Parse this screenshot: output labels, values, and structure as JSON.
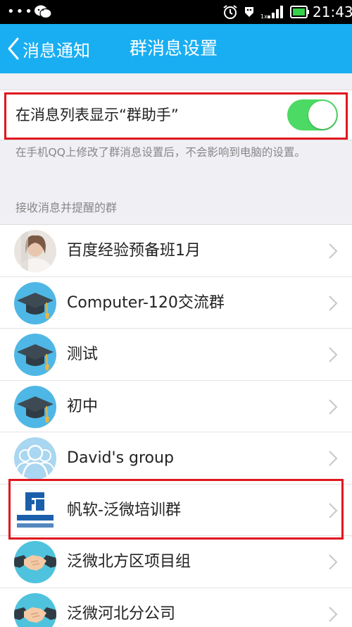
{
  "status_bar": {
    "time": "21:43",
    "left_dots": "•••"
  },
  "nav": {
    "back_label": "消息通知",
    "title": "群消息设置"
  },
  "toggle": {
    "label": "在消息列表显示“群助手”",
    "on": true
  },
  "hint": "在手机QQ上修改了群消息设置后，不会影响到电脑的设置。",
  "section_title": "接收消息并提醒的群",
  "groups": [
    {
      "name": "百度经验预备班1月",
      "avatar": "photo-avatar"
    },
    {
      "name": "Computer-120交流群",
      "avatar": "graduation-cap-avatar"
    },
    {
      "name": "测试",
      "avatar": "graduation-cap-avatar"
    },
    {
      "name": "初中",
      "avatar": "graduation-cap-avatar"
    },
    {
      "name": "David's group",
      "avatar": "people-avatar"
    },
    {
      "name": "帆软-泛微培训群",
      "avatar": "finereport-logo-avatar"
    },
    {
      "name": "泛微北方区项目组",
      "avatar": "handshake-avatar"
    },
    {
      "name": "泛微河北分公司",
      "avatar": "handshake-avatar"
    }
  ],
  "colors": {
    "nav_bg": "#19aef2",
    "switch_on": "#4cd964",
    "highlight": "#e0161f",
    "avatar_bg": "#4fb7e6"
  }
}
